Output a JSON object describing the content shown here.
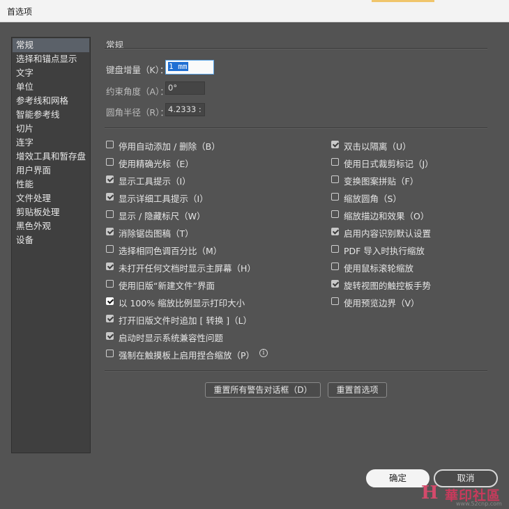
{
  "window": {
    "title": "首选项"
  },
  "sidebar": {
    "items": [
      {
        "label": "常规",
        "selected": true
      },
      {
        "label": "选择和锚点显示"
      },
      {
        "label": "文字"
      },
      {
        "label": "单位"
      },
      {
        "label": "参考线和网格"
      },
      {
        "label": "智能参考线"
      },
      {
        "label": "切片"
      },
      {
        "label": "连字"
      },
      {
        "label": "增效工具和暂存盘"
      },
      {
        "label": "用户界面"
      },
      {
        "label": "性能"
      },
      {
        "label": "文件处理"
      },
      {
        "label": "剪贴板处理"
      },
      {
        "label": "黑色外观"
      },
      {
        "label": "设备"
      }
    ]
  },
  "section": {
    "title": "常规"
  },
  "fields": {
    "keyboard_increment": {
      "label": "键盘增量（K）：",
      "value": "1 mm"
    },
    "constrain_angle": {
      "label": "约束角度（A）：",
      "value": "0°"
    },
    "corner_radius": {
      "label": "圆角半径（R）：",
      "value": "4.2333 :"
    }
  },
  "checkboxes_left": [
    {
      "label": "停用自动添加 / 删除（B）",
      "checked": false
    },
    {
      "label": "使用精确光标（E）",
      "checked": false
    },
    {
      "label": "显示工具提示（I）",
      "checked": true
    },
    {
      "label": "显示详细工具提示（I）",
      "checked": true
    },
    {
      "label": "显示 / 隐藏标尺（W）",
      "checked": false
    },
    {
      "label": "消除锯齿图稿（T）",
      "checked": true
    },
    {
      "label": "选择相同色调百分比（M）",
      "checked": false
    },
    {
      "label": "未打开任何文档时显示主屏幕（H）",
      "checked": true
    },
    {
      "label": "使用旧版“新建文件”界面",
      "checked": false
    },
    {
      "label": "以 100% 缩放比例显示打印大小",
      "checked": true,
      "focused": true
    },
    {
      "label": "打开旧版文件时追加 [ 转换 ]（L）",
      "checked": true
    },
    {
      "label": "启动时显示系统兼容性问题",
      "checked": true
    },
    {
      "label": "强制在触摸板上启用捏合缩放（P）",
      "checked": false
    }
  ],
  "checkboxes_right": [
    {
      "label": "双击以隔离（U）",
      "checked": true
    },
    {
      "label": "使用日式裁剪标记（J）",
      "checked": false
    },
    {
      "label": "变换图案拼贴（F）",
      "checked": false
    },
    {
      "label": "缩放圆角（S）",
      "checked": false
    },
    {
      "label": "缩放描边和效果（O）",
      "checked": false
    },
    {
      "label": "启用内容识别默认设置",
      "checked": true
    },
    {
      "label": "PDF 导入时执行缩放",
      "checked": false
    },
    {
      "label": "使用鼠标滚轮缩放",
      "checked": false
    },
    {
      "label": "旋转视图的触控板手势",
      "checked": true
    },
    {
      "label": "使用预览边界（V）",
      "checked": false
    }
  ],
  "buttons": {
    "reset_warnings": "重置所有警告对话框（D）",
    "reset_prefs": "重置首选项",
    "ok": "确定",
    "cancel": "取消"
  },
  "watermark": {
    "logo": "H",
    "text": "華印社區",
    "url": "www.52cnp.com"
  },
  "colors": {
    "background": "#535353",
    "sidebar": "#3f3f3f",
    "selection": "#5b6169",
    "accent_field": "#1f6fd3"
  }
}
